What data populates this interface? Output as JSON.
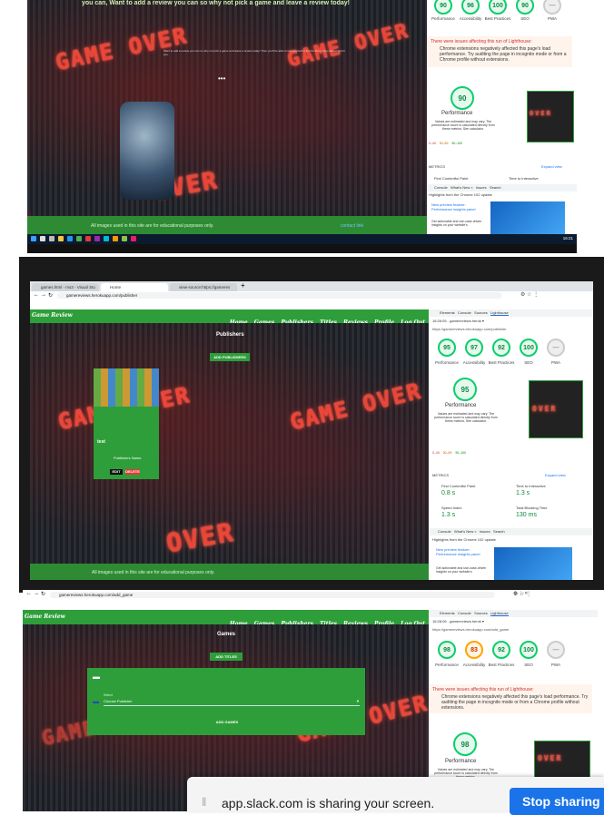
{
  "shot1": {
    "banner": "you can, Want to add a review you can so why not pick a game and leave a review today!",
    "body_text": "Want to add a review you can so why not pick a game and leave a review today! Then you'll be able to feel yourself to find for them, they will not fail for you.",
    "led1": "GAME OVER",
    "led2": "GAME OVER",
    "led3": "OVER",
    "footer": "All images used in this site are for educational purposes only.",
    "footer_link": "contact link",
    "lighthouse": {
      "scores": [
        {
          "v": "90",
          "l": "Performance"
        },
        {
          "v": "96",
          "l": "Accessibility"
        },
        {
          "v": "100",
          "l": "Best Practices"
        },
        {
          "v": "90",
          "l": "SEO"
        },
        {
          "v": "—",
          "l": "PWA"
        }
      ],
      "issue_title": "There were issues affecting this run of Lighthouse:",
      "issue_text": "Chrome extensions negatively affected this page's load performance. Try auditing the page in incognito mode or from a Chrome profile without extensions.",
      "perf_score": "90",
      "perf_label": "Performance",
      "perf_note": "Values are estimated and may vary. The performance score is calculated directly from these metrics. See calculator.",
      "legend": [
        "0–49",
        "50–89",
        "90–100"
      ],
      "metrics": "METRICS",
      "expand": "Expand view",
      "m1": "First Contentful Paint",
      "m2": "Time to Interactive",
      "console_tabs": [
        "Console",
        "What's New ×",
        "Issues",
        "Search"
      ],
      "highlights": "Highlights from the Chrome 102 update",
      "promo1": "New preview feature: Performance insights panel",
      "promo2": "Get actionable and use-case-driven insights on your website's"
    },
    "time": "16:21"
  },
  "shot2": {
    "tabs": [
      "games.html - ms3 - Visual Stu",
      "Home",
      "view-source:https://gameres"
    ],
    "url": "gamereviews.herokuapp.com/publisher",
    "bookmarks": [
      "Home - Replit",
      "HTML a tel Attribute",
      "Code Institute Org...",
      "any.py - Task Mana...",
      "githu - Yahoo Searc...",
      "routes.py - ms3 -..."
    ],
    "brand": "Game Review",
    "nav": [
      "Home",
      "Games",
      "Publishers",
      "Titles",
      "Reviews",
      "Profile",
      "Log Out"
    ],
    "page_title": "Publishers",
    "add_btn": "ADD PUBLISHERS",
    "card_title": "test",
    "card_sub": "Publishers Name",
    "edit": "EDIT",
    "delete": "DELETE",
    "led1": "GAME OVER",
    "led2": "GAME OVER",
    "led3": "OVER",
    "footer": "All images used in this site are for educational purposes only.",
    "devtools_tabs": [
      "Elements",
      "Console",
      "Sources",
      "Lighthouse"
    ],
    "report": "16:26:05 - gamereviews.herok ▾",
    "report_url": "https://gamereviews.herokuapp.com/publisher",
    "lighthouse": {
      "scores": [
        {
          "v": "95",
          "l": "Performance"
        },
        {
          "v": "97",
          "l": "Accessibility"
        },
        {
          "v": "92",
          "l": "Best Practices"
        },
        {
          "v": "100",
          "l": "SEO"
        },
        {
          "v": "—",
          "l": "PWA"
        }
      ],
      "perf_score": "95",
      "perf_label": "Performance",
      "perf_note": "Values are estimated and may vary. The performance score is calculated directly from these metrics. See calculator.",
      "legend": [
        "0–49",
        "50–89",
        "90–100"
      ],
      "metrics": "METRICS",
      "expand": "Expand view",
      "m": [
        {
          "l": "First Contentful Paint",
          "v": "0.8 s"
        },
        {
          "l": "Time to Interactive",
          "v": "1.3 s"
        },
        {
          "l": "Speed Index",
          "v": "1.3 s"
        },
        {
          "l": "Total Blocking Time",
          "v": "130 ms"
        }
      ],
      "console_tabs": [
        "Console",
        "What's New ×",
        "Issues",
        "Search"
      ],
      "highlights": "Highlights from the Chrome 102 update",
      "promo1": "New preview feature: Performance insights panel",
      "promo2": "Get actionable and use-case-driven insights on your website's"
    }
  },
  "shot3": {
    "url": "gamereviews.herokuapp.com/add_game",
    "bookmarks": [
      "Home - Replit",
      "HTML a tel Attribute",
      "Code Institute Org...",
      "any.py - Task Mana...",
      "githu - Yahoo Searc...",
      "routes.py - ms3 -..."
    ],
    "brand": "Game Review",
    "nav": [
      "Home",
      "Games",
      "Publishers",
      "Titles",
      "Reviews",
      "Profile",
      "Log Out"
    ],
    "page_title": "Games",
    "add_btn": "ADD TITLES",
    "select_label": "Select",
    "select_value": "Choose Publisher",
    "submit": "ADD GAMES",
    "led1": "GAME OVER",
    "led2": "GAME OVER",
    "devtools_tabs": [
      "Elements",
      "Console",
      "Sources",
      "Lighthouse"
    ],
    "report": "16:28:06 - gamereviews.herok ▾",
    "report_url": "https://gamereviews.herokuapp.com/add_game",
    "lighthouse": {
      "scores": [
        {
          "v": "98",
          "l": "Performance"
        },
        {
          "v": "83",
          "l": "Accessibility"
        },
        {
          "v": "92",
          "l": "Best Practices"
        },
        {
          "v": "100",
          "l": "SEO"
        },
        {
          "v": "—",
          "l": "PWA"
        }
      ],
      "issue_title": "There were issues affecting this run of Lighthouse:",
      "issue_text": "Chrome extensions negatively affected this page's load performance. Try auditing the page in incognito mode or from a Chrome profile without extensions.",
      "perf_score": "98",
      "perf_label": "Performance",
      "perf_note": "Values are estimated and may vary. The performance score is calculated directly from these metrics."
    }
  },
  "share_bar": {
    "text": "app.slack.com is sharing your screen.",
    "button": "Stop sharing"
  }
}
